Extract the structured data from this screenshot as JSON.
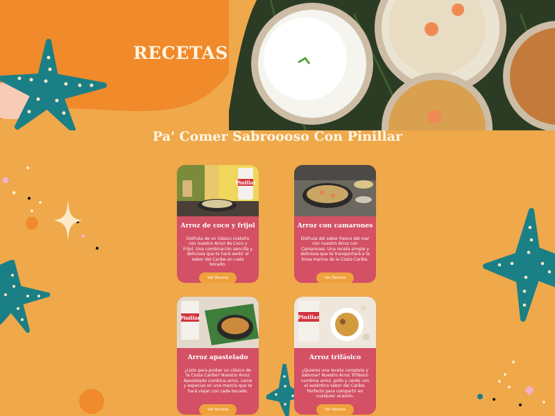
{
  "hero": {
    "title": "RECETAS"
  },
  "section": {
    "title": "Pa' Comer Sabroooso Con Pinillar"
  },
  "brand": {
    "package_text": "Pinillar"
  },
  "colors": {
    "background": "#efa84a",
    "accent": "#f08a2a",
    "starfish": "#1b7f86",
    "card": "#d35065",
    "button": "#efa23b"
  },
  "recipes": [
    {
      "title": "Arroz de coco y frijol",
      "description": "Disfruta de un clásico costeño con nuestro Arroz de Coco y Fríjol. Una combinación sencilla y deliciosa que te hará sentir el sabor del Caribe en cada bocado.",
      "button": "Ver Receta"
    },
    {
      "title": "Arroz con camarones",
      "description": "Disfruta del sabor fresco del mar con nuestro Arroz con Camarones. Una receta simple y deliciosa que te transportará a la brisa marina de la Costa Caribe.",
      "button": "Ver Receta"
    },
    {
      "title": "Arroz apastelado",
      "description": "¿Listo para probar un clásico de la Costa Caribe? Nuestro Arroz Apastelado combina arroz, carne y especias en una mezcla que te hará viajar con cada bocado.",
      "button": "Ver Receta"
    },
    {
      "title": "Arroz trifásico",
      "description": "¿Quieres una receta completa y sabrosa? Nuestro Arroz Trifásico combina arroz, pollo y cerdo con el auténtico sabor del Caribe. Perfecto para compartir en cualquier ocasión.",
      "button": "Ver Receta"
    }
  ]
}
